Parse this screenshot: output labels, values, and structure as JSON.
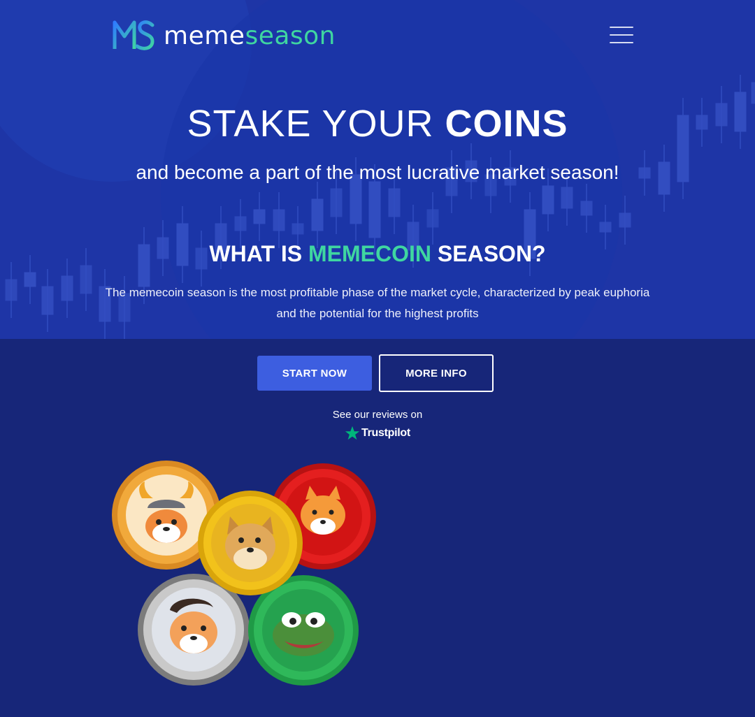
{
  "brand": {
    "logo_mark": "MS",
    "name_part1": "meme",
    "name_part2": "season",
    "colors": {
      "mark_blue": "#2f7cff",
      "mark_green": "#3fd6a0",
      "accent_green": "#3fd6a0"
    }
  },
  "header": {
    "menu_icon": "hamburger-menu-icon"
  },
  "hero": {
    "headline_light": "STAKE YOUR ",
    "headline_bold": "COINS",
    "subheadline": "and become a part of the most lucrative market season!",
    "question_prefix": "WHAT IS ",
    "question_accent": "MEMECOIN",
    "question_suffix": " SEASON?",
    "description": "The memecoin season is the most profitable phase of the market cycle, characterized by peak euphoria and the potential for the highest profits"
  },
  "actions": {
    "start_label": "START NOW",
    "more_label": "MORE INFO"
  },
  "reviews": {
    "text": "See our reviews on",
    "trustpilot_label": "Trustpilot",
    "trustpilot_icon": "trustpilot-star-icon"
  },
  "coins": [
    {
      "name": "viking-shiba-coin",
      "color": "#f1a93b"
    },
    {
      "name": "shiba-inu-coin",
      "color": "#e41f1f"
    },
    {
      "name": "dogecoin",
      "color": "#f2c21b"
    },
    {
      "name": "baby-doge-coin",
      "color": "#a9a9a9"
    },
    {
      "name": "pepe-coin",
      "color": "#2fb85a"
    }
  ]
}
